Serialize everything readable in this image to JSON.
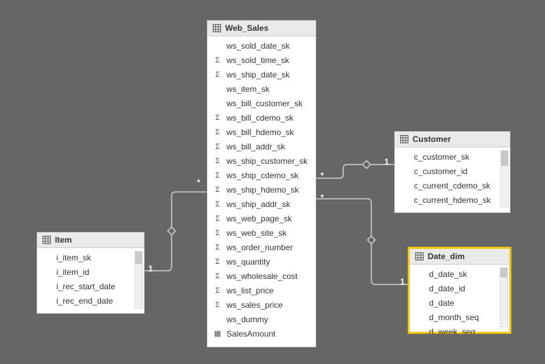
{
  "entities": {
    "web_sales": {
      "title": "Web_Sales",
      "fields": [
        {
          "icon": "",
          "name": "ws_sold_date_sk"
        },
        {
          "icon": "Σ",
          "name": "ws_sold_time_sk"
        },
        {
          "icon": "Σ",
          "name": "ws_ship_date_sk"
        },
        {
          "icon": "",
          "name": "ws_item_sk"
        },
        {
          "icon": "",
          "name": "ws_bill_customer_sk"
        },
        {
          "icon": "Σ",
          "name": "ws_bill_cdemo_sk"
        },
        {
          "icon": "Σ",
          "name": "ws_bill_hdemo_sk"
        },
        {
          "icon": "Σ",
          "name": "ws_bill_addr_sk"
        },
        {
          "icon": "Σ",
          "name": "ws_ship_customer_sk"
        },
        {
          "icon": "Σ",
          "name": "ws_ship_cdemo_sk"
        },
        {
          "icon": "Σ",
          "name": "ws_ship_hdemo_sk"
        },
        {
          "icon": "Σ",
          "name": "ws_ship_addr_sk"
        },
        {
          "icon": "Σ",
          "name": "ws_web_page_sk"
        },
        {
          "icon": "Σ",
          "name": "ws_web_site_sk"
        },
        {
          "icon": "Σ",
          "name": "ws_order_number"
        },
        {
          "icon": "Σ",
          "name": "ws_quantity"
        },
        {
          "icon": "Σ",
          "name": "ws_wholesale_cost"
        },
        {
          "icon": "Σ",
          "name": "ws_list_price"
        },
        {
          "icon": "Σ",
          "name": "ws_sales_price"
        },
        {
          "icon": "",
          "name": "ws_dummy"
        },
        {
          "icon": "▦",
          "name": "SalesAmount"
        }
      ]
    },
    "item": {
      "title": "Item",
      "fields": [
        {
          "icon": "",
          "name": "i_item_sk"
        },
        {
          "icon": "",
          "name": "i_item_id"
        },
        {
          "icon": "",
          "name": "i_rec_start_date"
        },
        {
          "icon": "",
          "name": "i_rec_end_date"
        }
      ]
    },
    "customer": {
      "title": "Customer",
      "fields": [
        {
          "icon": "",
          "name": "c_customer_sk"
        },
        {
          "icon": "",
          "name": "c_customer_id"
        },
        {
          "icon": "",
          "name": "c_current_cdemo_sk"
        },
        {
          "icon": "",
          "name": "c_current_hdemo_sk"
        }
      ]
    },
    "date_dim": {
      "title": "Date_dim",
      "fields": [
        {
          "icon": "",
          "name": "d_date_sk"
        },
        {
          "icon": "",
          "name": "d_date_id"
        },
        {
          "icon": "",
          "name": "d_date"
        },
        {
          "icon": "",
          "name": "d_month_seq"
        },
        {
          "icon": "",
          "name": "d_week_seq"
        }
      ]
    }
  },
  "cardinality": {
    "item_one": "1",
    "item_many": "*",
    "customer_one": "1",
    "customer_many": "*",
    "date_one": "1",
    "date_many": "*"
  }
}
